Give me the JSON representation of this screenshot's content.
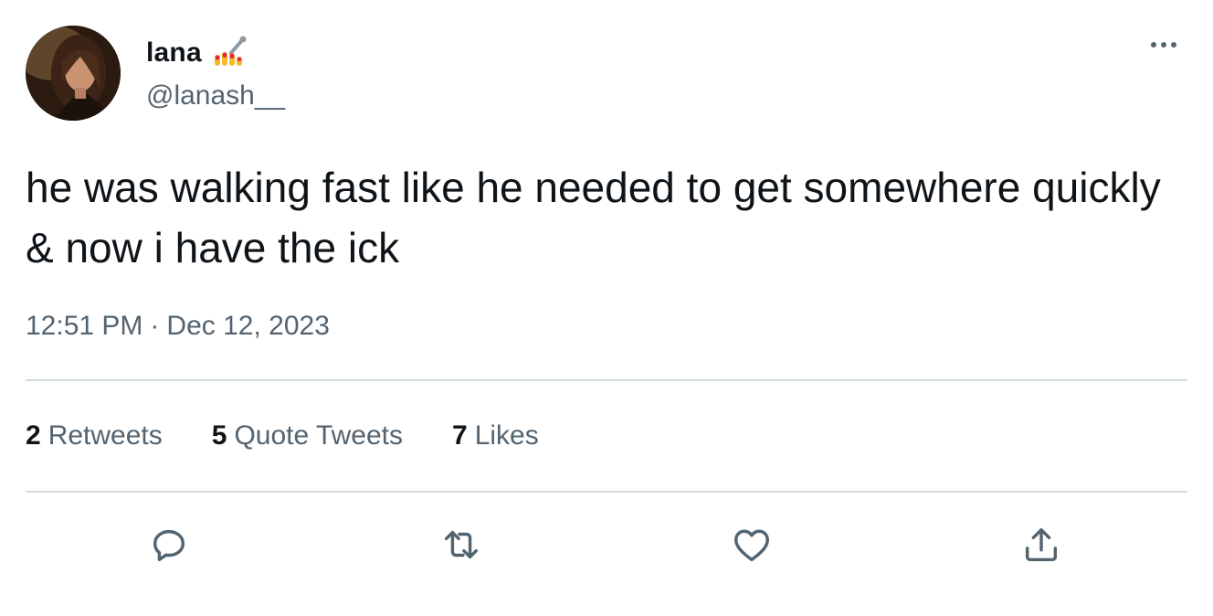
{
  "author": {
    "display_name": "lana",
    "name_emoji": "nail-polish-emoji",
    "handle": "@lanash__",
    "avatar": "profile-photo"
  },
  "tweet": {
    "text": "he was walking fast like he needed to get somewhere quickly & now i have the ick",
    "time": "12:51 PM",
    "separator": "·",
    "date": "Dec 12, 2023"
  },
  "stats": [
    {
      "count": "2",
      "label": "Retweets"
    },
    {
      "count": "5",
      "label": "Quote Tweets"
    },
    {
      "count": "7",
      "label": "Likes"
    }
  ],
  "actions": {
    "reply": "reply-icon",
    "retweet": "retweet-icon",
    "like": "heart-icon",
    "share": "share-icon"
  },
  "colors": {
    "text_primary": "#0f1419",
    "text_secondary": "#536471",
    "divider": "#cfd9de",
    "icon": "#536471"
  }
}
